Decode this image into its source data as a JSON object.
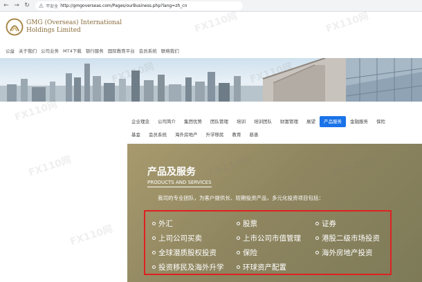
{
  "browser": {
    "insecure_label": "不安全",
    "url": "http://gmgoverseas.com/Pages/ourBusiness.php?lang=zh_cn"
  },
  "header": {
    "logo_line1": "GMG (Overseas) International",
    "logo_line2": "Holdings Limited"
  },
  "top_nav": [
    "公益",
    "关于我们",
    "公司业务",
    "MT4下载",
    "银行服务",
    "国际教育平台",
    "会员系统",
    "联络我们"
  ],
  "sub_nav": {
    "row1": [
      "企业理念",
      "公司简介",
      "集团优势",
      "团队管理",
      "培训",
      "培训团队",
      "财富管理",
      "展望",
      "产品服务",
      "金融服务",
      "保险"
    ],
    "row2": [
      "基金",
      "会员系统",
      "海外房地产",
      "升学移民",
      "教育",
      "慈善"
    ],
    "active": "产品服务"
  },
  "products": {
    "title": "产品及服务",
    "subtitle": "PRODUCTS AND SERVICES",
    "description": "我司的专业团队，为客户提供长、短期投资产品，多元化投资项目包括：",
    "services": [
      "外汇",
      "股票",
      "证券",
      "上司公司买卖",
      "上市公司市值管理",
      "港股二级市场投资",
      "全球潜质股权投资",
      "保险",
      "海外房地产投资",
      "投资移民及海外升学",
      "环球资产配置"
    ]
  },
  "watermark_text": "FX110网"
}
